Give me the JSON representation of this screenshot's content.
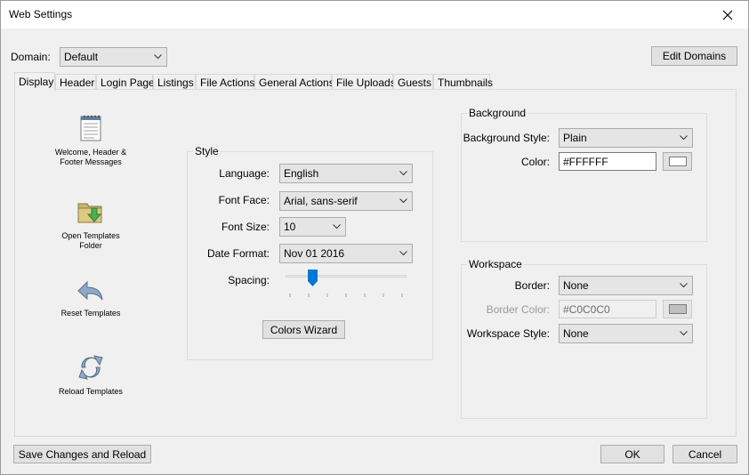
{
  "window": {
    "title": "Web Settings"
  },
  "domain": {
    "label": "Domain:",
    "value": "Default",
    "edit_button": "Edit Domains"
  },
  "tabs": [
    "Display",
    "Header",
    "Login Page",
    "Listings",
    "File Actions",
    "General Actions",
    "File Uploads",
    "Guests",
    "Thumbnails"
  ],
  "sidebar": {
    "items": [
      {
        "label": "Welcome, Header & Footer Messages",
        "icon": "notepad-icon"
      },
      {
        "label": "Open Templates Folder",
        "icon": "folder-down-arrow-icon"
      },
      {
        "label": "Reset Templates",
        "icon": "undo-arrow-icon"
      },
      {
        "label": "Reload Templates",
        "icon": "reload-arrows-icon"
      }
    ]
  },
  "style": {
    "title": "Style",
    "language": {
      "label": "Language:",
      "value": "English"
    },
    "font_face": {
      "label": "Font Face:",
      "value": "Arial, sans-serif"
    },
    "font_size": {
      "label": "Font Size:",
      "value": "10"
    },
    "date_format": {
      "label": "Date Format:",
      "value": "Nov 01 2016"
    },
    "spacing": {
      "label": "Spacing:",
      "level": 0.2
    },
    "wizard_button": "Colors Wizard"
  },
  "background": {
    "title": "Background",
    "style": {
      "label": "Background Style:",
      "value": "Plain"
    },
    "color": {
      "label": "Color:",
      "value": "#FFFFFF",
      "swatch": "#FFFFFF"
    }
  },
  "workspace": {
    "title": "Workspace",
    "border": {
      "label": "Border:",
      "value": "None"
    },
    "border_color": {
      "label": "Border Color:",
      "value": "#C0C0C0",
      "swatch": "#C0C0C0"
    },
    "style": {
      "label": "Workspace Style:",
      "value": "None"
    }
  },
  "footer": {
    "save_reload": "Save Changes and Reload",
    "ok": "OK",
    "cancel": "Cancel"
  }
}
